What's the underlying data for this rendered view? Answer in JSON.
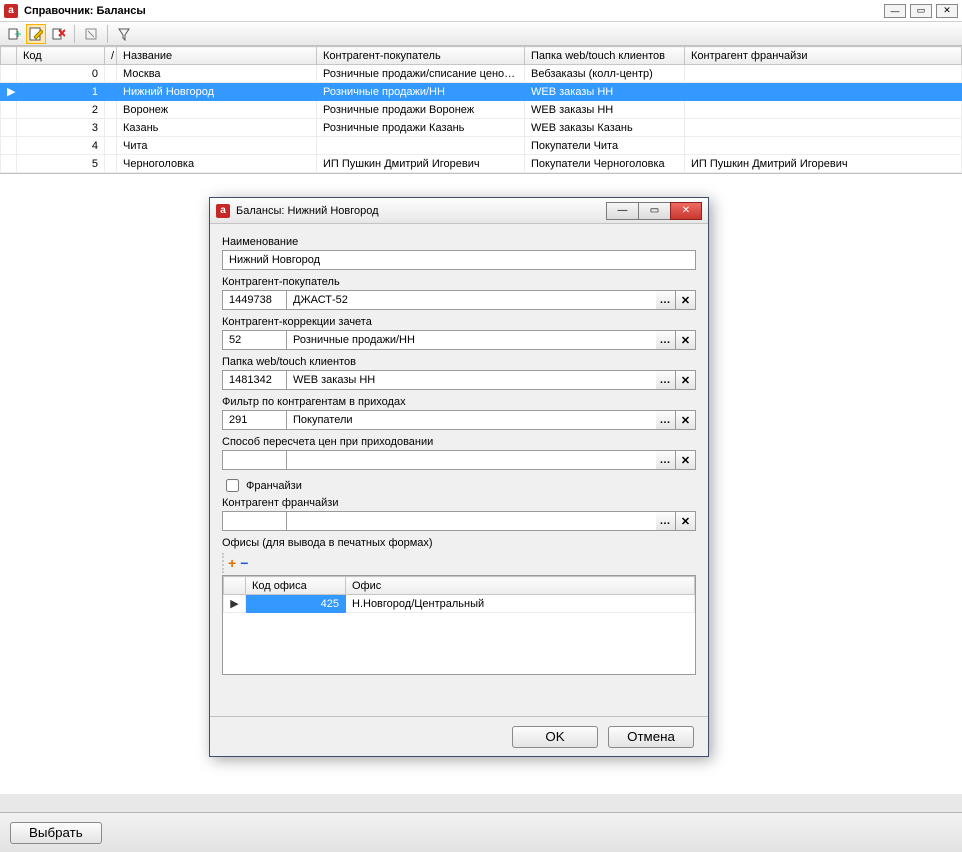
{
  "main": {
    "title": "Справочник: Балансы",
    "select_button": "Выбрать"
  },
  "grid": {
    "headers": {
      "marker": "",
      "code": "Код",
      "sort": "/",
      "name": "Название",
      "buyer": "Контрагент-покупатель",
      "folder": "Папка web/touch клиентов",
      "franch": "Контрагент франчайзи"
    },
    "rows": [
      {
        "code": "0",
        "name": "Москва",
        "buyer": "Розничные продажи/списание ценово...",
        "folder": "Вебзаказы (колл-центр)",
        "franch": ""
      },
      {
        "code": "1",
        "name": "Нижний Новгород",
        "buyer": "Розничные продажи/НН",
        "folder": "WEB заказы НН",
        "franch": "",
        "selected": true,
        "marker": "▶"
      },
      {
        "code": "2",
        "name": "Воронеж",
        "buyer": "Розничные продажи Воронеж",
        "folder": "WEB заказы НН",
        "franch": ""
      },
      {
        "code": "3",
        "name": "Казань",
        "buyer": "Розничные продажи Казань",
        "folder": "WEB заказы Казань",
        "franch": ""
      },
      {
        "code": "4",
        "name": "Чита",
        "buyer": "",
        "folder": "Покупатели Чита",
        "franch": ""
      },
      {
        "code": "5",
        "name": "Черноголовка",
        "buyer": "ИП Пушкин Дмитрий Игоревич",
        "folder": "Покупатели Черноголовка",
        "franch": "ИП Пушкин Дмитрий Игоревич"
      }
    ]
  },
  "dialog": {
    "title": "Балансы: Нижний Новгород",
    "labels": {
      "name": "Наименование",
      "buyer": "Контрагент-покупатель",
      "corr": "Контрагент-коррекции зачета",
      "folder": "Папка web/touch клиентов",
      "filter": "Фильтр по контрагентам в приходах",
      "recalc": "Способ пересчета цен при приходовании",
      "franch_chk": "Франчайзи",
      "franch": "Контрагент франчайзи",
      "offices": "Офисы (для вывода в печатных формах)"
    },
    "values": {
      "name": "Нижний Новгород",
      "buyer_code": "1449738",
      "buyer_name": "ДЖАСТ-52",
      "corr_code": "52",
      "corr_name": "Розничные продажи/НН",
      "folder_code": "1481342",
      "folder_name": "WEB заказы НН",
      "filter_code": "291",
      "filter_name": "Покупатели",
      "recalc_code": "",
      "recalc_name": "",
      "franch_checked": false,
      "franch_code": "",
      "franch_name": ""
    },
    "offices": {
      "headers": {
        "code": "Код офиса",
        "name": "Офис"
      },
      "rows": [
        {
          "marker": "▶",
          "code": "425",
          "name": "Н.Новгород/Центральный",
          "selected": true
        }
      ]
    },
    "buttons": {
      "ok": "OK",
      "cancel": "Отмена"
    }
  },
  "glyphs": {
    "ellipsis": "…",
    "close": "✕",
    "plus": "+",
    "minus": "−"
  }
}
